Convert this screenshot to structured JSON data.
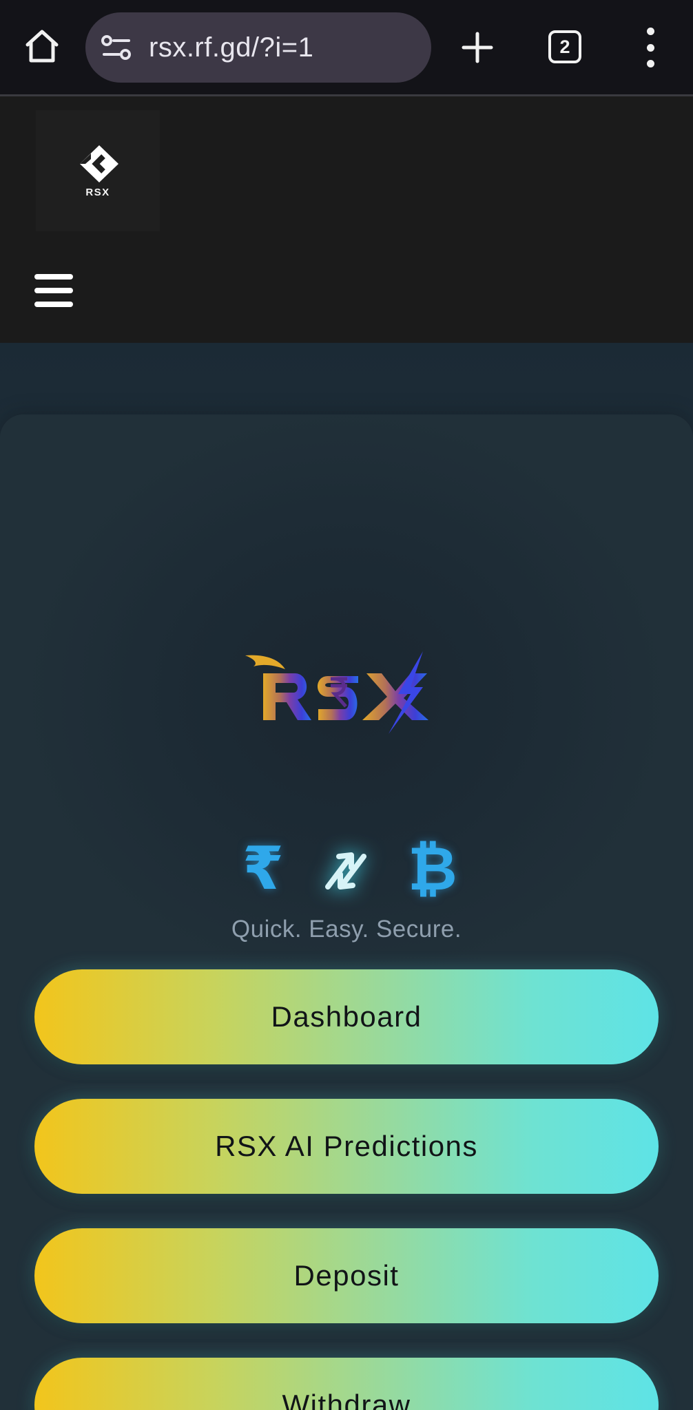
{
  "browser": {
    "url": "rsx.rf.gd/?i=1",
    "tab_count": "2"
  },
  "header": {
    "logo_text": "RSX"
  },
  "hero": {
    "brand_logo_icon": "rsx-brand-logo",
    "exchange_icons": {
      "left": "₹",
      "middle": "swap-arrows-icon",
      "right": "₿"
    },
    "tagline": "Quick. Easy. Secure."
  },
  "nav": {
    "dashboard": "Dashboard",
    "predictions": "RSX AI Predictions",
    "deposit": "Deposit",
    "withdraw": "Withdraw"
  },
  "colors": {
    "browser_bg": "#131318",
    "url_pill": "#3d3846",
    "header_bg": "#1b1b1b",
    "main_bg": "#24343f",
    "accent_cyan": "#2fa8ea",
    "button_gradient_start": "#f2c51c",
    "button_gradient_end": "#5ee3e6"
  }
}
